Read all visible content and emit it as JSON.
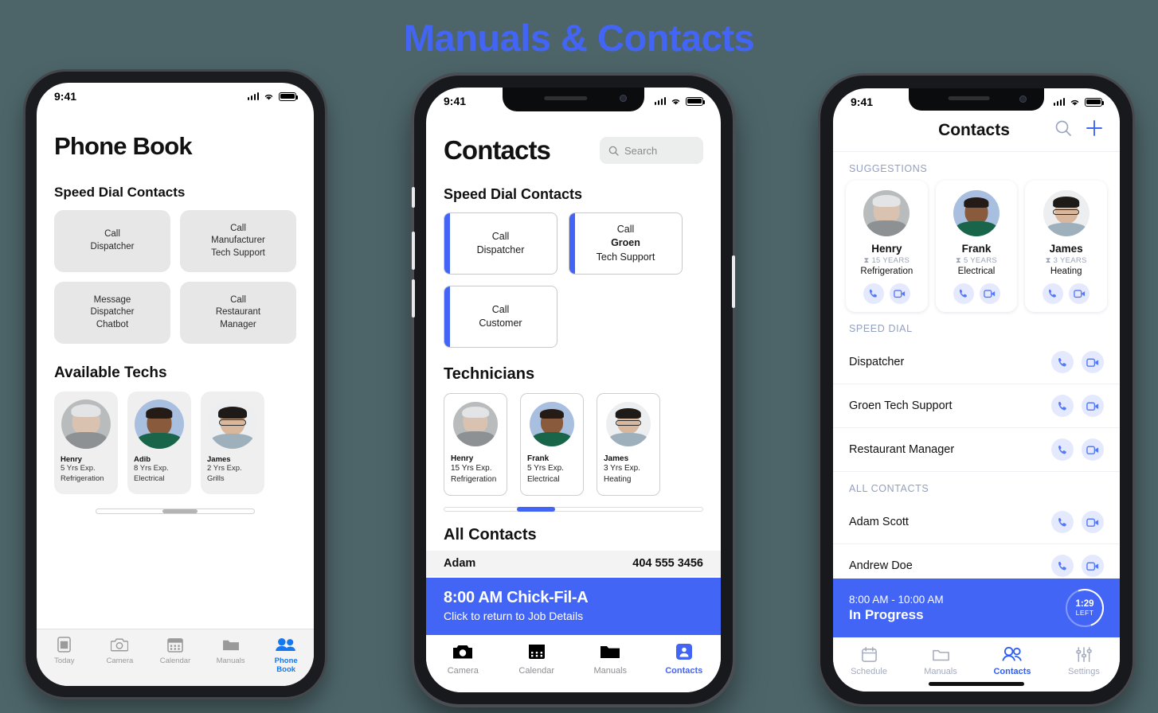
{
  "page": {
    "title": "Manuals & Contacts",
    "accent": "#4365f6",
    "background": "#4d6569"
  },
  "phone1": {
    "status": {
      "time": "9:41"
    },
    "title": "Phone Book",
    "speed_dial_heading": "Speed Dial Contacts",
    "speed_dial": [
      {
        "line1": "Call",
        "line2": "Dispatcher",
        "line3": ""
      },
      {
        "line1": "Call",
        "line2": "Manufacturer",
        "line3": "Tech Support"
      },
      {
        "line1": "Message",
        "line2": "Dispatcher",
        "line3": "Chatbot"
      },
      {
        "line1": "Call",
        "line2": "Restaurant",
        "line3": "Manager"
      }
    ],
    "techs_heading": "Available Techs",
    "techs": [
      {
        "name": "Henry",
        "exp": "5 Yrs Exp.",
        "spec": "Refrigeration",
        "avatar": "henry"
      },
      {
        "name": "Adib",
        "exp": "8 Yrs Exp.",
        "spec": "Electrical",
        "avatar": "adib"
      },
      {
        "name": "James",
        "exp": "2 Yrs Exp.",
        "spec": "Grills",
        "avatar": "james"
      }
    ],
    "tabs": [
      {
        "label": "Today",
        "icon": "today-icon",
        "active": false
      },
      {
        "label": "Camera",
        "icon": "camera-icon",
        "active": false
      },
      {
        "label": "Calendar",
        "icon": "calendar-icon",
        "active": false
      },
      {
        "label": "Manuals",
        "icon": "folder-icon",
        "active": false
      },
      {
        "label": "Phone",
        "label2": "Book",
        "icon": "people-icon",
        "active": true
      }
    ]
  },
  "phone2": {
    "status": {
      "time": "9:41"
    },
    "title": "Contacts",
    "search_placeholder": "Search",
    "speed_dial_heading": "Speed Dial Contacts",
    "speed_dial": [
      {
        "line1": "Call",
        "line2": "Dispatcher",
        "line2_bold": false,
        "line3": ""
      },
      {
        "line1": "Call",
        "line2": "Groen",
        "line2_bold": true,
        "line3": "Tech Support"
      },
      {
        "line1": "Call",
        "line2": "Customer",
        "line2_bold": false,
        "line3": ""
      }
    ],
    "techs_heading": "Technicians",
    "techs": [
      {
        "name": "Henry",
        "exp": "15 Yrs Exp.",
        "spec": "Refrigeration",
        "avatar": "henry"
      },
      {
        "name": "Frank",
        "exp": "5 Yrs Exp.",
        "spec": "Electrical",
        "avatar": "frank"
      },
      {
        "name": "James",
        "exp": "3 Yrs Exp.",
        "spec": "Heating",
        "avatar": "james"
      }
    ],
    "all_contacts_heading": "All Contacts",
    "first_contact": {
      "name": "Adam",
      "phone": "404 555 3456"
    },
    "banner": {
      "line1": "8:00 AM Chick-Fil-A",
      "line2": "Click to return to Job Details"
    },
    "tabs": [
      {
        "label": "Camera",
        "icon": "camera-icon",
        "active": false
      },
      {
        "label": "Calendar",
        "icon": "calendar-icon",
        "active": false
      },
      {
        "label": "Manuals",
        "icon": "folder-icon",
        "active": false
      },
      {
        "label": "Contacts",
        "icon": "contact-card-icon",
        "active": true
      }
    ]
  },
  "phone3": {
    "status": {
      "time": "9:41"
    },
    "nav_title": "Contacts",
    "suggestions_heading": "SUGGESTIONS",
    "suggestions": [
      {
        "name": "Henry",
        "years": "15 YEARS",
        "spec": "Refrigeration",
        "avatar": "henry"
      },
      {
        "name": "Frank",
        "years": "5 YEARS",
        "spec": "Electrical",
        "avatar": "frank"
      },
      {
        "name": "James",
        "years": "3 YEARS",
        "spec": "Heating",
        "avatar": "james"
      }
    ],
    "speed_dial_heading": "SPEED DIAL",
    "speed_dial": [
      {
        "label": "Dispatcher"
      },
      {
        "label": "Groen Tech Support"
      },
      {
        "label": "Restaurant Manager"
      }
    ],
    "all_contacts_heading": "ALL CONTACTS",
    "all_contacts": [
      {
        "label": "Adam Scott"
      },
      {
        "label": "Andrew Doe"
      }
    ],
    "banner": {
      "line1": "8:00 AM - 10:00 AM",
      "line2": "In Progress",
      "timer_value": "1:29",
      "timer_label": "LEFT"
    },
    "tabs": [
      {
        "label": "Schedule",
        "icon": "calendar-icon",
        "active": false
      },
      {
        "label": "Manuals",
        "icon": "folder-icon",
        "active": false
      },
      {
        "label": "Contacts",
        "icon": "people-icon",
        "active": true
      },
      {
        "label": "Settings",
        "icon": "sliders-icon",
        "active": false
      }
    ]
  }
}
